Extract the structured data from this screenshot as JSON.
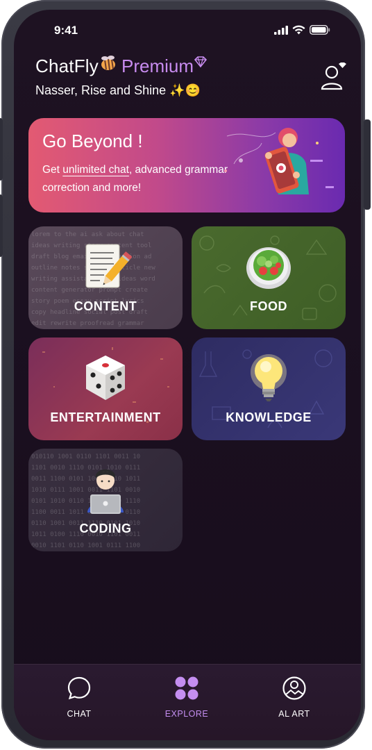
{
  "status_bar": {
    "time": "9:41"
  },
  "header": {
    "brand_name": "ChatFly",
    "brand_tier": "Premium",
    "greeting": "Nasser, Rise and Shine ✨😊"
  },
  "banner": {
    "title": "Go Beyond !",
    "text_prefix": "Get ",
    "text_underlined": "unlimited chat",
    "text_suffix": ", advanced grammar correction and more!"
  },
  "categories": [
    {
      "label": "CONTENT",
      "icon": "memo-icon"
    },
    {
      "label": "FOOD",
      "icon": "salad-icon"
    },
    {
      "label": "ENTERTAINMENT",
      "icon": "dice-icon"
    },
    {
      "label": "KNOWLEDGE",
      "icon": "light-bulb-icon"
    },
    {
      "label": "CODING",
      "icon": "coder-icon"
    }
  ],
  "bottom_nav": {
    "items": [
      {
        "label": "CHAT",
        "icon": "chat-bubble-icon",
        "active": false
      },
      {
        "label": "EXPLORE",
        "icon": "grid-icon",
        "active": true
      },
      {
        "label": "AL ART",
        "icon": "image-icon",
        "active": false
      }
    ]
  },
  "colors": {
    "accent": "#c48ef0",
    "background": "#1c1020",
    "banner_start": "#e35a72",
    "banner_end": "#6a2ab0"
  }
}
